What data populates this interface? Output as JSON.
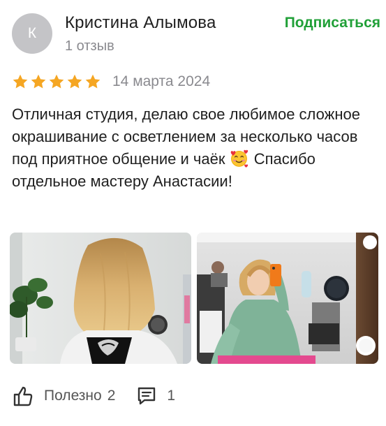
{
  "author": {
    "initial": "К",
    "name": "Кристина Алымова",
    "review_count": "1 отзыв",
    "subscribe_label": "Подписаться"
  },
  "review": {
    "rating": 5,
    "date": "14 марта 2024",
    "text_before_emoji": "Отличная студия, делаю свое любимое сложное окрашивание с осветлением за несколько часов под приятное общение и чаёк",
    "text_after_emoji": " Спасибо отдельное мастеру Анастасии!"
  },
  "photos": [
    {
      "name": "photo-hair-back-view"
    },
    {
      "name": "photo-mirror-selfie"
    }
  ],
  "actions": {
    "useful_label": "Полезно",
    "useful_count": "2",
    "comments_count": "1"
  },
  "colors": {
    "accent_green": "#21a038",
    "star_gold": "#f5a623",
    "muted_text": "#8a8a8f",
    "avatar_bg": "#c4c4c7"
  },
  "icons": [
    "star-icon",
    "smiling-face-with-hearts-icon",
    "thumbs-up-icon",
    "comment-icon"
  ]
}
